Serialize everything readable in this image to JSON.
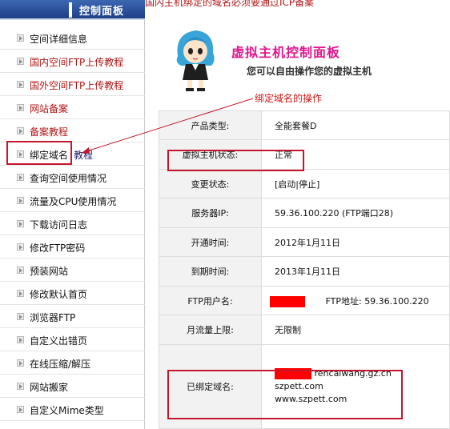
{
  "sidebar": {
    "title": "控制面板",
    "items": [
      {
        "label": "空间详细信息",
        "color": "default"
      },
      {
        "label": "国内空间FTP上传教程",
        "color": "red"
      },
      {
        "label": "国外空间FTP上传教程",
        "color": "red"
      },
      {
        "label": "网站备案",
        "color": "red"
      },
      {
        "label": "备案教程",
        "color": "red"
      },
      {
        "label": "绑定域名",
        "color": "default",
        "extra": "教程"
      },
      {
        "label": "查询空间使用情况",
        "color": "default"
      },
      {
        "label": "流量及CPU使用情况",
        "color": "default"
      },
      {
        "label": "下载访问日志",
        "color": "default"
      },
      {
        "label": "修改FTP密码",
        "color": "default"
      },
      {
        "label": "预装网站",
        "color": "default"
      },
      {
        "label": "修改默认首页",
        "color": "default"
      },
      {
        "label": "浏览器FTP",
        "color": "default"
      },
      {
        "label": "自定义出错页",
        "color": "default"
      },
      {
        "label": "在线压缩/解压",
        "color": "default"
      },
      {
        "label": "网站搬家",
        "color": "default"
      },
      {
        "label": "自定义Mime类型",
        "color": "default"
      }
    ]
  },
  "main": {
    "top_notice": "国内主机绑定的域名必须要通过ICP备案",
    "panel_title": "虚拟主机控制面板",
    "panel_subtitle": "您可以自由操作您的虚拟主机",
    "annotation": "绑定域名的操作",
    "rows": {
      "product_type": {
        "label": "产品类型:",
        "value": "全能套餐D"
      },
      "host_status": {
        "label": "虚拟主机状态:",
        "value": "正常"
      },
      "change_status": {
        "label": "变更状态:",
        "value": "[启动|停止]"
      },
      "server_ip": {
        "label": "服务器IP:",
        "value": "59.36.100.220 (FTP端口28)"
      },
      "open_time": {
        "label": "开通时间:",
        "value": "2012年1月11日"
      },
      "expire_time": {
        "label": "到期时间:",
        "value": "2013年1月11日"
      },
      "ftp_user": {
        "label": "FTP用户名:",
        "ftp_address": "FTP地址: 59.36.100.220"
      },
      "traffic_limit": {
        "label": "月流量上限:",
        "value": "无限制"
      },
      "bound_domains": {
        "label": "已绑定域名:",
        "domains": [
          "rencaiwang.gz.cn",
          "szpett.com",
          "www.szpett.com"
        ]
      }
    }
  },
  "colors": {
    "header_blue": "#2a4f9b",
    "highlight_red": "#c4162c",
    "title_pink": "#e0178e",
    "redaction": "#ff0000"
  }
}
